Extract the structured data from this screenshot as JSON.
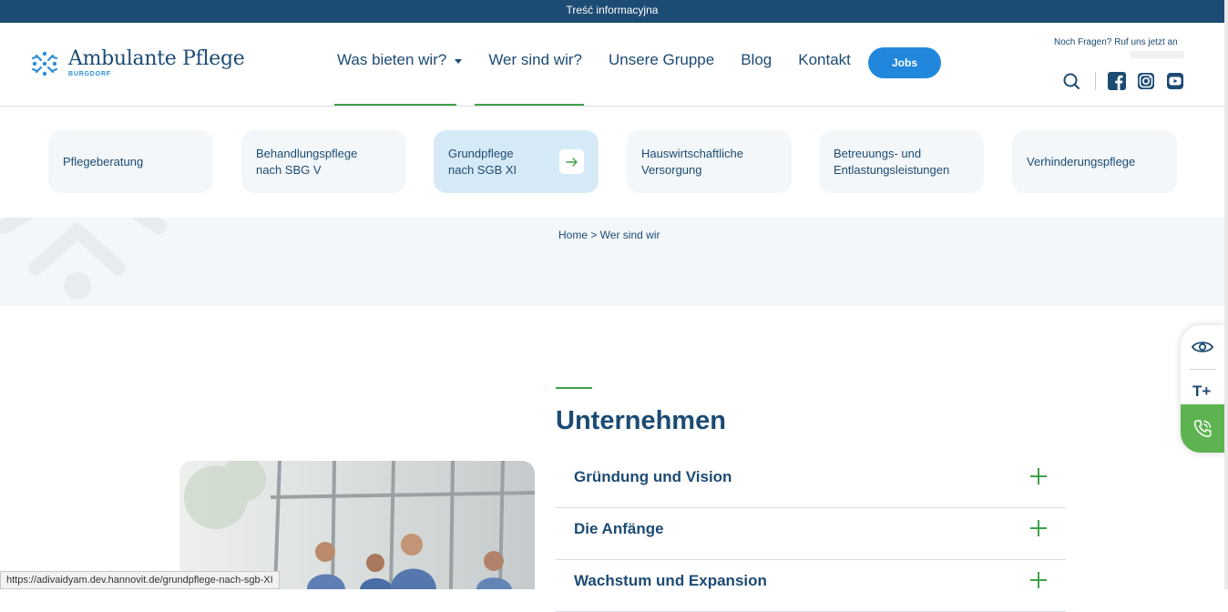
{
  "topbar": {
    "text": "Treść informacyjna"
  },
  "logo": {
    "title": "Ambulante Pflege",
    "subtitle": "BURGDORF"
  },
  "nav": {
    "items": [
      "Was bieten wir?",
      "Wer sind wir?",
      "Unsere Gruppe",
      "Blog",
      "Kontakt"
    ],
    "jobs_label": "Jobs"
  },
  "contact": {
    "note": "Noch Fragen? Ruf uns jetzt an"
  },
  "subnav": {
    "cards": [
      {
        "line1": "Pflegeberatung",
        "line2": ""
      },
      {
        "line1": "Behandlungspflege",
        "line2": "nach SBG V"
      },
      {
        "line1": "Grundpflege",
        "line2": "nach SGB XI"
      },
      {
        "line1": "Hauswirtschaftliche",
        "line2": "Versorgung"
      },
      {
        "line1": "Betreuungs- und",
        "line2": "Entlastungsleistungen"
      },
      {
        "line1": "Verhinderungspflege",
        "line2": ""
      }
    ]
  },
  "breadcrumb": "Home > Wer sind wir",
  "section": {
    "title": "Unternehmen",
    "accordion": [
      "Gründung und Vision",
      "Die Anfänge",
      "Wachstum und Expansion"
    ]
  },
  "widget": {
    "text_size_label": "T+"
  },
  "status_url": "https://adivaidyam.dev.hannovit.de/grundpflege-nach-sgb-XI",
  "colors": {
    "primary": "#1c4b73",
    "accent": "#2187dd",
    "green": "#3fa14a",
    "light_bg": "#f3f7f9"
  },
  "icons": [
    "logo-mark-icon",
    "search-icon",
    "facebook-icon",
    "instagram-icon",
    "youtube-icon",
    "arrow-right-icon",
    "plus-icon",
    "eye-icon",
    "phone-icon"
  ]
}
